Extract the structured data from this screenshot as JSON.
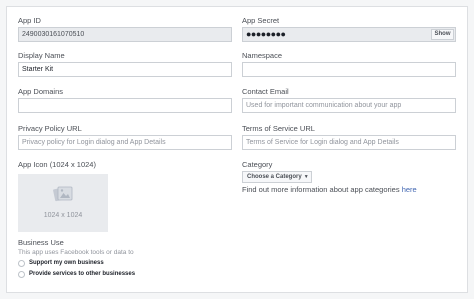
{
  "fields": {
    "app_id": {
      "label": "App ID",
      "value": "2490030161070510"
    },
    "app_secret": {
      "label": "App Secret",
      "value": "●●●●●●●●",
      "show_label": "Show"
    },
    "display_name": {
      "label": "Display Name",
      "value": "Starter Kit"
    },
    "namespace": {
      "label": "Namespace",
      "value": ""
    },
    "app_domains": {
      "label": "App Domains",
      "value": ""
    },
    "contact_email": {
      "label": "Contact Email",
      "placeholder": "Used for important communication about your app"
    },
    "privacy_policy": {
      "label": "Privacy Policy URL",
      "placeholder": "Privacy policy for Login dialog and App Details"
    },
    "terms_of_service": {
      "label": "Terms of Service URL",
      "placeholder": "Terms of Service for Login dialog and App Details"
    }
  },
  "app_icon": {
    "label": "App Icon (1024 x 1024)",
    "size_text": "1024 x 1024"
  },
  "category": {
    "label": "Category",
    "button_label": "Choose a Category",
    "info_text": "Find out more information about app categories",
    "info_link": "here"
  },
  "business_use": {
    "label": "Business Use",
    "subtext": "This app uses Facebook tools or data to",
    "options": [
      "Support my own business",
      "Provide services to other businesses"
    ]
  }
}
